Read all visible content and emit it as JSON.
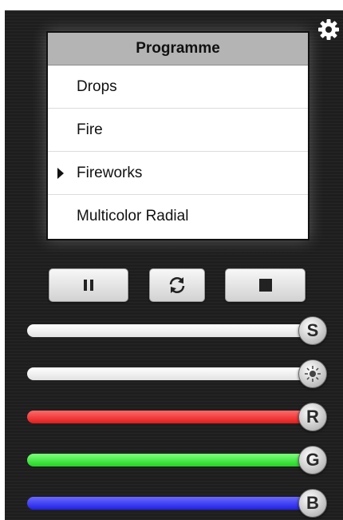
{
  "programme": {
    "header": "Programme",
    "items": [
      {
        "label": "Drops",
        "selected": false
      },
      {
        "label": "Fire",
        "selected": false
      },
      {
        "label": "Fireworks",
        "selected": true
      },
      {
        "label": "Multicolor Radial",
        "selected": false
      }
    ]
  },
  "controls": {
    "pause_icon": "pause-icon",
    "refresh_icon": "refresh-icon",
    "stop_icon": "stop-icon",
    "settings_icon": "gear-icon"
  },
  "sliders": [
    {
      "id": "speed",
      "knob_label": "S",
      "color": "#ffffff",
      "value": 1.0
    },
    {
      "id": "brightness",
      "knob_label": "",
      "icon": "sun-icon",
      "color": "#ffffff",
      "value": 1.0
    },
    {
      "id": "red",
      "knob_label": "R",
      "color": "#ff3b3b",
      "value": 1.0
    },
    {
      "id": "green",
      "knob_label": "G",
      "color": "#3ef23e",
      "value": 1.0
    },
    {
      "id": "blue",
      "knob_label": "B",
      "color": "#3b3bff",
      "value": 1.0
    }
  ]
}
